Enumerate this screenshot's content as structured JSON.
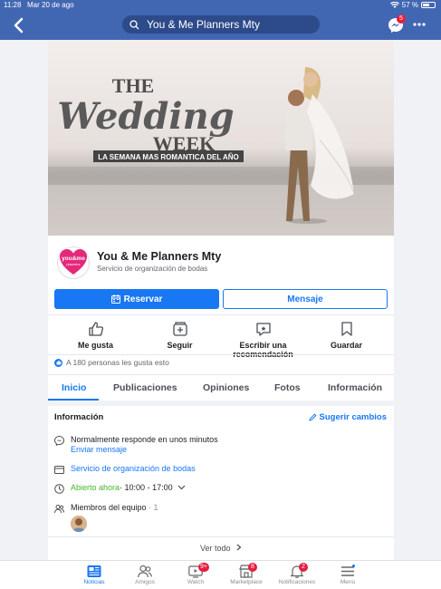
{
  "status_bar": {
    "time": "11:28",
    "date": "Mar 20 de ago",
    "battery": "57 %"
  },
  "nav": {
    "search_text": "You & Me Planners Mty",
    "messenger_badge": "5"
  },
  "cover": {
    "title_line1": "THE",
    "title_line2": "Wedding",
    "title_line3": "WEEK",
    "subtitle": "LA SEMANA MAS ROMANTICA DEL AÑO"
  },
  "page": {
    "name": "You & Me Planners Mty",
    "category": "Servicio de organización de bodas",
    "logo_text": "you&me",
    "logo_sub": "planners"
  },
  "buttons": {
    "reserve": "Reservar",
    "message": "Mensaje"
  },
  "actions": [
    {
      "label": "Me gusta",
      "icon": "thumbs-up-icon"
    },
    {
      "label": "Seguir",
      "icon": "follow-icon"
    },
    {
      "label": "Escribir una recomendación",
      "icon": "recommend-icon"
    },
    {
      "label": "Guardar",
      "icon": "bookmark-icon"
    }
  ],
  "likes_text": "A 180 personas les gusta esto",
  "tabs": [
    "Inicio",
    "Publicaciones",
    "Opiniones",
    "Fotos",
    "Información"
  ],
  "info": {
    "heading": "Información",
    "suggest": "Sugerir cambios",
    "response": "Normalmente responde en unos minutos",
    "send_message": "Enviar mensaje",
    "category_link": "Servicio de organización de bodas",
    "open_now": "Abierto ahora",
    "hours": " · 10:00 - 17:00",
    "team_label": "Miembros del equipo",
    "team_count": "· 1",
    "see_all": "Ver todo"
  },
  "bottom_nav": [
    {
      "label": "Noticias",
      "icon": "news-icon",
      "badge": ""
    },
    {
      "label": "Amigos",
      "icon": "friends-icon",
      "badge": ""
    },
    {
      "label": "Watch",
      "icon": "watch-icon",
      "badge": "9+"
    },
    {
      "label": "Marketplace",
      "icon": "marketplace-icon",
      "badge": "8"
    },
    {
      "label": "Notificaciones",
      "icon": "bell-icon",
      "badge": "2"
    },
    {
      "label": "Menú",
      "icon": "menu-icon",
      "badge": ""
    }
  ],
  "colors": {
    "brand": "#4267b2",
    "accent": "#1877f2",
    "badge": "#e41e3f"
  }
}
